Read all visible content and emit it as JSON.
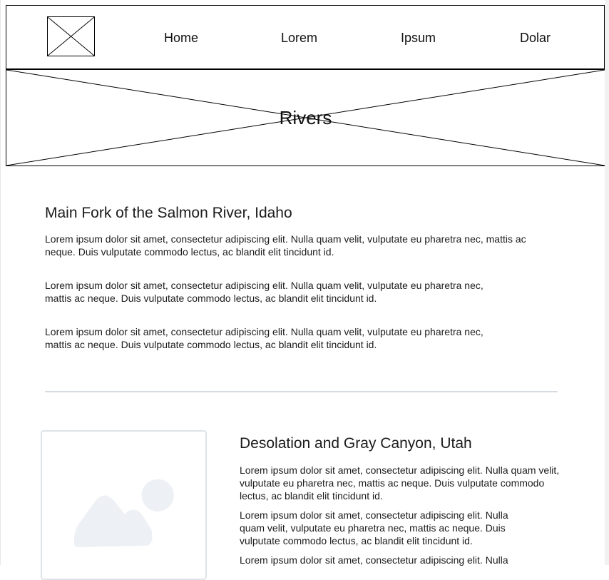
{
  "nav": {
    "logo_icon": "image-placeholder-icon",
    "items": [
      {
        "label": "Home"
      },
      {
        "label": "Lorem"
      },
      {
        "label": "Ipsum"
      },
      {
        "label": "Dolar"
      }
    ]
  },
  "hero": {
    "title": "Rivers",
    "icon": "image-placeholder-icon"
  },
  "section1": {
    "heading": "Main Fork of the Salmon River, Idaho",
    "paragraphs": [
      "Lorem ipsum dolor sit amet, consectetur adipiscing elit. Nulla quam velit, vulputate eu pharetra nec, mattis ac neque. Duis vulputate commodo lectus, ac blandit elit tincidunt id.",
      "Lorem ipsum dolor sit amet, consectetur adipiscing elit. Nulla quam velit, vulputate eu pharetra nec, mattis ac neque. Duis vulputate commodo lectus, ac blandit elit tincidunt id.",
      "Lorem ipsum dolor sit amet, consectetur adipiscing elit. Nulla quam velit, vulputate eu pharetra nec, mattis ac neque. Duis vulputate commodo lectus, ac blandit elit tincidunt id."
    ]
  },
  "section2": {
    "image_icon": "mountain-image-placeholder-icon",
    "heading": "Desolation and Gray Canyon, Utah",
    "paragraphs": [
      "Lorem ipsum dolor sit amet, consectetur adipiscing elit. Nulla quam velit, vulputate eu pharetra nec, mattis ac neque. Duis vulputate commodo lectus, ac blandit elit tincidunt id.",
      "Lorem ipsum dolor sit amet, consectetur adipiscing elit. Nulla quam velit, vulputate eu pharetra nec, mattis ac neque. Duis vulputate commodo lectus, ac blandit elit tincidunt id.",
      "Lorem ipsum dolor sit amet, consectetur adipiscing elit. Nulla"
    ]
  },
  "colors": {
    "border": "#000000",
    "divider": "#d6dbe1",
    "placeholder_fill": "#edf0f4",
    "placeholder_border": "#dfe3e8"
  }
}
